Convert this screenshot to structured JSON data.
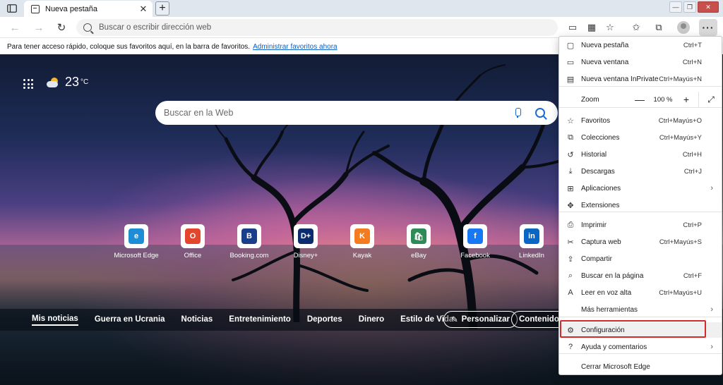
{
  "tab": {
    "title": "Nueva pestaña",
    "close": "✕"
  },
  "toolbar": {
    "new_tab": "+",
    "omnibox_placeholder": "Buscar o escribir dirección web",
    "more": "···"
  },
  "favorites_bar": {
    "text": "Para tener acceso rápido, coloque sus favoritos aquí, en la barra de favoritos.",
    "link": "Administrar favoritos ahora"
  },
  "weather": {
    "temp": "23",
    "unit": "°C"
  },
  "web_search": {
    "placeholder": "Buscar en la Web"
  },
  "quick_links": [
    {
      "label": "Microsoft Edge",
      "color": "#1f8dd6",
      "glyph": "e"
    },
    {
      "label": "Office",
      "color": "#e2462d",
      "glyph": "O"
    },
    {
      "label": "Booking.com",
      "color": "#1b3e8a",
      "glyph": "B"
    },
    {
      "label": "Disney+",
      "color": "#0c2c6e",
      "glyph": "D+"
    },
    {
      "label": "Kayak",
      "color": "#f47b20",
      "glyph": "K"
    },
    {
      "label": "eBay",
      "color": "#2e8b57",
      "glyph": "🛍"
    },
    {
      "label": "Facebook",
      "color": "#1877f2",
      "glyph": "f"
    },
    {
      "label": "LinkedIn",
      "color": "#0a66c2",
      "glyph": "in"
    }
  ],
  "news": {
    "tabs": [
      "Mis noticias",
      "Guerra en Ucrania",
      "Noticias",
      "Entretenimiento",
      "Deportes",
      "Dinero",
      "Estilo de Vida"
    ],
    "personalize": "Personalizar",
    "content": "Contenido p"
  },
  "menu": {
    "items": [
      {
        "label": "Nueva pestaña",
        "shortcut": "Ctrl+T",
        "icon": "new-tab-icon"
      },
      {
        "label": "Nueva ventana",
        "shortcut": "Ctrl+N",
        "icon": "new-window-icon"
      },
      {
        "label": "Nueva ventana InPrivate",
        "shortcut": "Ctrl+Mayús+N",
        "icon": "inprivate-icon"
      },
      {
        "label": "Zoom",
        "shortcut": "",
        "icon": "zoom"
      },
      {
        "label": "Favoritos",
        "shortcut": "Ctrl+Mayús+O",
        "icon": "favorites-icon"
      },
      {
        "label": "Colecciones",
        "shortcut": "Ctrl+Mayús+Y",
        "icon": "collections-icon"
      },
      {
        "label": "Historial",
        "shortcut": "Ctrl+H",
        "icon": "history-icon"
      },
      {
        "label": "Descargas",
        "shortcut": "Ctrl+J",
        "icon": "download-icon"
      },
      {
        "label": "Aplicaciones",
        "shortcut": "",
        "icon": "apps-icon"
      },
      {
        "label": "Extensiones",
        "shortcut": "",
        "icon": "extensions-icon"
      },
      {
        "label": "Imprimir",
        "shortcut": "Ctrl+P",
        "icon": "print-icon"
      },
      {
        "label": "Captura web",
        "shortcut": "Ctrl+Mayús+S",
        "icon": "web-capture-icon"
      },
      {
        "label": "Compartir",
        "shortcut": "",
        "icon": "share-icon"
      },
      {
        "label": "Buscar en la página",
        "shortcut": "Ctrl+F",
        "icon": "find-icon"
      },
      {
        "label": "Leer en voz alta",
        "shortcut": "Ctrl+Mayús+U",
        "icon": "read-aloud-icon"
      },
      {
        "label": "Más herramientas",
        "shortcut": "",
        "icon": ""
      },
      {
        "label": "Configuración",
        "shortcut": "",
        "icon": "settings-icon"
      },
      {
        "label": "Ayuda y comentarios",
        "shortcut": "",
        "icon": "help-icon"
      },
      {
        "label": "Cerrar Microsoft Edge",
        "shortcut": "",
        "icon": ""
      }
    ],
    "zoom_value": "100 %",
    "zoom_minus": "—",
    "zoom_plus": "+"
  }
}
